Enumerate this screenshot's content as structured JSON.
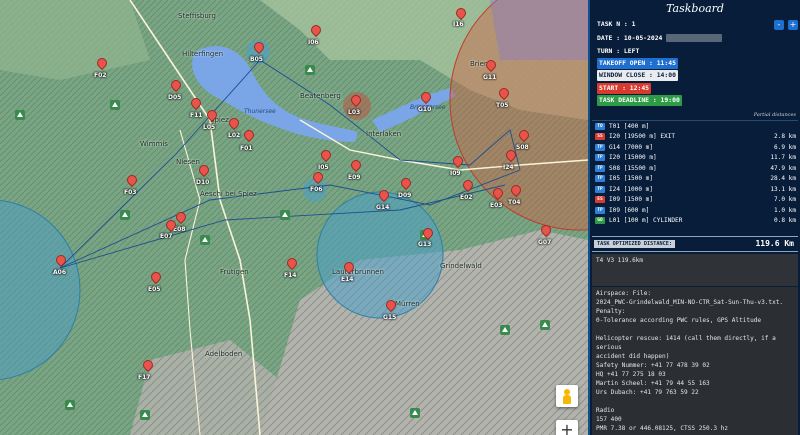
{
  "taskboard": {
    "title": "Taskboard",
    "task_number": "TASK N : 1",
    "date": "DATE : 10-05-2024",
    "turn": "TURN : LEFT",
    "takeoff_open": "TAKEOFF OPEN : 11:45",
    "window_close": "WINDOW CLOSE : 14:00",
    "start": "START : 12:45",
    "task_deadline": "TASK DEADLINE : 19:00",
    "minus_label": "-",
    "plus_label": "+",
    "partial_distances_label": "Partial distances",
    "turnpoints": [
      {
        "type": "TO",
        "color": "#2f7fd6",
        "desc": "T01 [400 m]",
        "dist": ""
      },
      {
        "type": "SS",
        "color": "#d93a2f",
        "desc": "I20 [19500 m] EXIT",
        "dist": "2.8 km"
      },
      {
        "type": "TP",
        "color": "#2f7fd6",
        "desc": "G14 [7000 m]",
        "dist": "6.9 km"
      },
      {
        "type": "TP",
        "color": "#2f7fd6",
        "desc": "I20 [15000 m]",
        "dist": "11.7 km"
      },
      {
        "type": "TP",
        "color": "#2f7fd6",
        "desc": "S08 [15500 m]",
        "dist": "47.9 km"
      },
      {
        "type": "TP",
        "color": "#2f7fd6",
        "desc": "I05 [1500 m]",
        "dist": "28.4 km"
      },
      {
        "type": "TP",
        "color": "#2f7fd6",
        "desc": "I24 [1000 m]",
        "dist": "13.1 km"
      },
      {
        "type": "ES",
        "color": "#d93a2f",
        "desc": "I09 [1500 m]",
        "dist": "7.0 km"
      },
      {
        "type": "TP",
        "color": "#2f7fd6",
        "desc": "I09 [600 m]",
        "dist": "1.0 km"
      },
      {
        "type": "GO",
        "color": "#2e9b47",
        "desc": "L01 [100 m] CYLINDER",
        "dist": "0.8 km"
      }
    ],
    "optimized_label": "TASK OPTIMIZED DISTANCE:",
    "optimized_value": "119.6 Km",
    "summary": "T4 V3 119.6km",
    "info": {
      "airspace_label": "Airspace: File:",
      "airspace_file": "2024_PWC-Grindelwald_MIN-NO-CTR_Sat-Sun-Thu-v3.txt.",
      "penalty_label": "Penalty:",
      "penalty_text": "0-Tolerance according PWC rules, GPS Altitude",
      "heli_1": "Helicopter rescue: 1414 (call them directly, if a serious",
      "heli_2": "accident did happen)",
      "safety": "Safety Nummer: +41 77 478 39 02",
      "hq": "HQ +41 77 275 18 03",
      "martin": "Martin Scheel: +41 79 44 55 163",
      "urs": "Urs Dubach: +41 79 763 59 22",
      "radio_label": "Radio",
      "radio_freq": "157 400",
      "pmr": "PMR 7.38 or 446.08125, CTSS 250.3 hz"
    }
  },
  "map": {
    "places": [
      {
        "name": "Steffisburg"
      },
      {
        "name": "Hilterfingen"
      },
      {
        "name": "Wimmis"
      },
      {
        "name": "Spiez"
      },
      {
        "name": "Aeschi bei Spiez"
      },
      {
        "name": "Niesen"
      },
      {
        "name": "Frutigen"
      },
      {
        "name": "Adelboden"
      },
      {
        "name": "Interlaken"
      },
      {
        "name": "Brienz"
      },
      {
        "name": "Lauterbrunnen"
      },
      {
        "name": "Grindelwald"
      },
      {
        "name": "Mürren"
      },
      {
        "name": "Beatenberg"
      },
      {
        "name": "Thunersee"
      },
      {
        "name": "Brienzersee"
      }
    ],
    "waypoints": [
      {
        "label": "B05"
      },
      {
        "label": "F01"
      },
      {
        "label": "F11"
      },
      {
        "label": "L05"
      },
      {
        "label": "L02"
      },
      {
        "label": "I05"
      },
      {
        "label": "I09"
      },
      {
        "label": "I24"
      },
      {
        "label": "S08"
      },
      {
        "label": "F06"
      },
      {
        "label": "G14"
      },
      {
        "label": "G13"
      },
      {
        "label": "E14"
      },
      {
        "label": "E08"
      },
      {
        "label": "F14"
      },
      {
        "label": "E07"
      },
      {
        "label": "E03"
      },
      {
        "label": "E02"
      },
      {
        "label": "D09"
      },
      {
        "label": "T04"
      },
      {
        "label": "I06"
      },
      {
        "label": "L03"
      },
      {
        "label": "F17"
      },
      {
        "label": "G07"
      },
      {
        "label": "G10"
      },
      {
        "label": "T05"
      },
      {
        "label": "G11"
      },
      {
        "label": "A06"
      },
      {
        "label": "D05"
      },
      {
        "label": "F03"
      },
      {
        "label": "D10"
      },
      {
        "label": "E09"
      },
      {
        "label": "I16"
      },
      {
        "label": "F02"
      },
      {
        "label": "G15"
      },
      {
        "label": "E05"
      }
    ]
  }
}
